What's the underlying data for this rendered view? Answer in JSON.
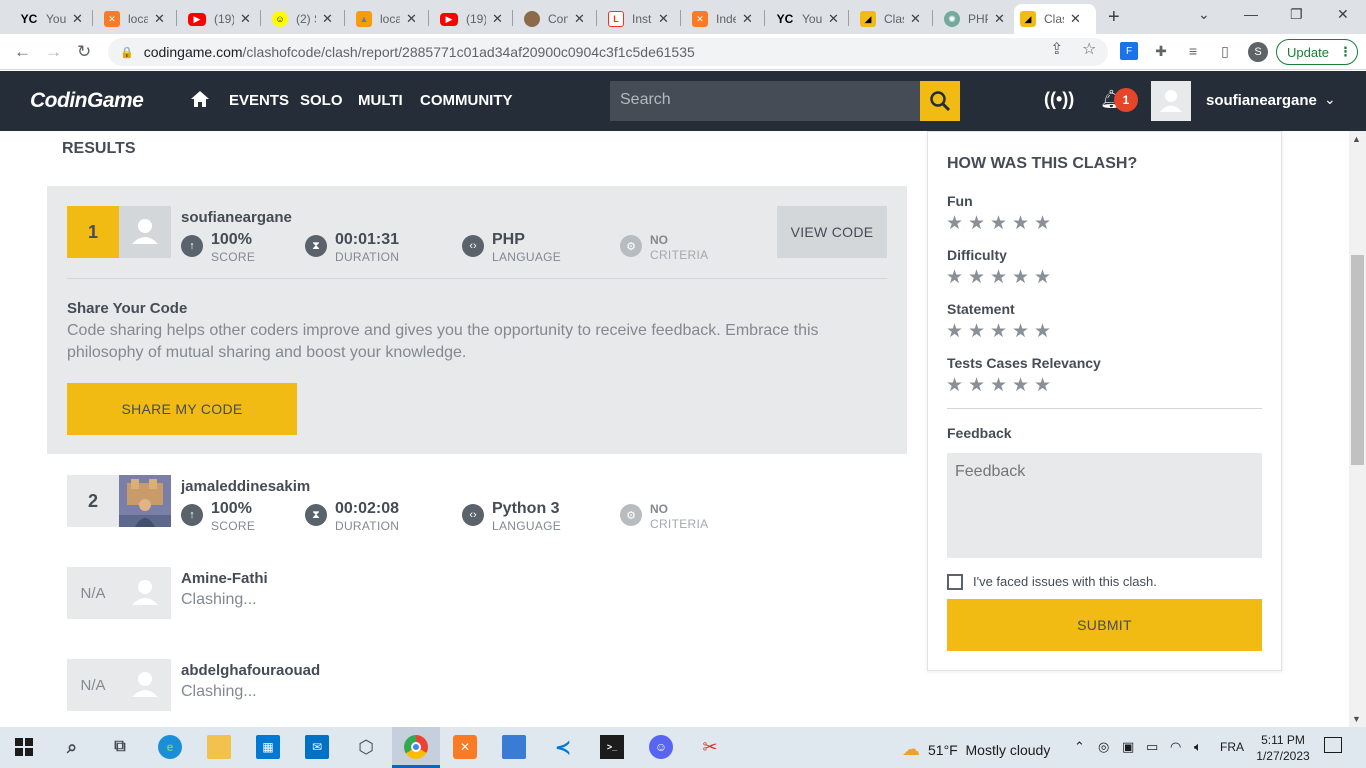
{
  "browser": {
    "tabs": [
      {
        "label": "You",
        "icon": "yc-icon",
        "text": "YC"
      },
      {
        "label": "loca",
        "icon": "xampp-icon",
        "text": ""
      },
      {
        "label": "(19)",
        "icon": "youtube-icon",
        "text": ""
      },
      {
        "label": "(2) S",
        "icon": "snapchat-icon",
        "text": ""
      },
      {
        "label": "loca",
        "icon": "phpmyadmin-icon",
        "text": ""
      },
      {
        "label": "(19)",
        "icon": "youtube-icon",
        "text": ""
      },
      {
        "label": "Con",
        "icon": "avatar-icon",
        "text": ""
      },
      {
        "label": "Inst",
        "icon": "laravel-icon",
        "text": ""
      },
      {
        "label": "Inde",
        "icon": "xampp-icon",
        "text": ""
      },
      {
        "label": "You",
        "icon": "yc-icon",
        "text": "YC"
      },
      {
        "label": "Clas",
        "icon": "codingame-icon",
        "text": ""
      },
      {
        "label": "PHP",
        "icon": "chatgpt-icon",
        "text": ""
      },
      {
        "label": "Clas",
        "icon": "codingame-icon",
        "text": ""
      }
    ],
    "url_host": "codingame.com",
    "url_path": "/clashofcode/clash/report/2885771c01ad34af20900c0904c3f1c5de61535",
    "profile_initial": "S",
    "update_label": "Update"
  },
  "nav": {
    "logo_part1": "Codin",
    "logo_part2": "Game",
    "items": [
      "EVENTS",
      "SOLO",
      "MULTI",
      "COMMUNITY"
    ],
    "search_placeholder": "Search",
    "notif_count": "1",
    "username": "soufianeargane"
  },
  "results": {
    "title": "RESULTS",
    "players": [
      {
        "rank": "1",
        "name": "soufianeargane",
        "score": "100%",
        "score_lbl": "SCORE",
        "duration": "00:01:31",
        "duration_lbl": "DURATION",
        "language": "PHP",
        "language_lbl": "LANGUAGE",
        "criteria": "NO",
        "criteria_lbl": "CRITERIA"
      },
      {
        "rank": "2",
        "name": "jamaleddinesakim",
        "score": "100%",
        "score_lbl": "SCORE",
        "duration": "00:02:08",
        "duration_lbl": "DURATION",
        "language": "Python 3",
        "language_lbl": "LANGUAGE",
        "criteria": "NO",
        "criteria_lbl": "CRITERIA"
      },
      {
        "rank": "N/A",
        "name": "Amine-Fathi",
        "status": "Clashing..."
      },
      {
        "rank": "N/A",
        "name": "abdelghafourаouad",
        "status": "Clashing..."
      }
    ],
    "view_code_label": "VIEW CODE",
    "share_title": "Share Your Code",
    "share_desc": "Code sharing helps other coders improve and gives you the opportunity to receive feedback. Embrace this philosophy of mutual sharing and boost your knowledge.",
    "share_button": "SHARE MY CODE"
  },
  "feedback": {
    "title": "HOW WAS THIS CLASH?",
    "ratings": [
      "Fun",
      "Difficulty",
      "Statement",
      "Tests Cases Relevancy"
    ],
    "star_rating_value": 0,
    "feedback_label": "Feedback",
    "feedback_placeholder": "Feedback",
    "issues_label": "I've faced issues with this clash.",
    "submit_label": "SUBMIT"
  },
  "taskbar": {
    "weather_temp": "51°F",
    "weather_desc": "Mostly cloudy",
    "lang": "FRA",
    "time": "5:11 PM",
    "date": "1/27/2023"
  },
  "colors": {
    "accent": "#f2bb13",
    "nav_bg": "#252e38",
    "panel_bg": "#e7e9eb",
    "text": "#454c55"
  }
}
